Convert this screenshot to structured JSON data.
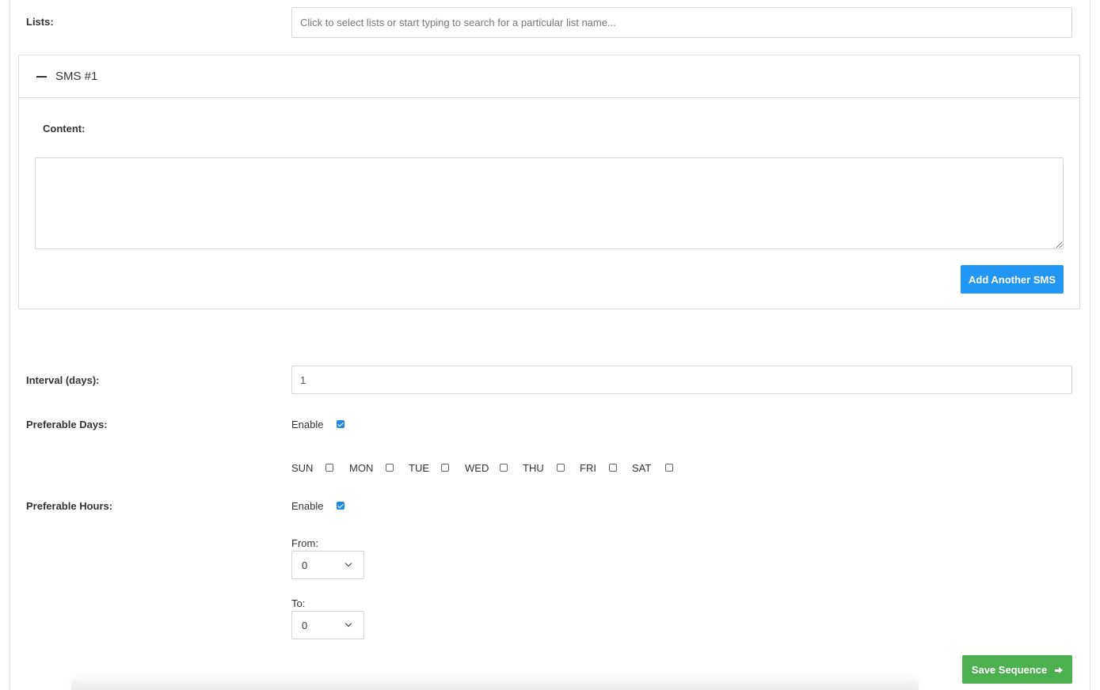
{
  "lists": {
    "label": "Lists:",
    "placeholder": "Click to select lists or start typing to search for a particular list name..."
  },
  "sms_panel": {
    "title": "SMS #1",
    "collapse_icon": "minus-icon",
    "content_label": "Content:",
    "content_value": "",
    "add_button_label": "Add Another SMS"
  },
  "interval": {
    "label": "Interval (days):",
    "value": "1"
  },
  "preferable_days": {
    "label": "Preferable Days:",
    "enable_label": "Enable",
    "enabled": true,
    "days": [
      {
        "label": "SUN",
        "checked": false
      },
      {
        "label": "MON",
        "checked": false
      },
      {
        "label": "TUE",
        "checked": false
      },
      {
        "label": "WED",
        "checked": false
      },
      {
        "label": "THU",
        "checked": false
      },
      {
        "label": "FRI",
        "checked": false
      },
      {
        "label": "SAT",
        "checked": false
      }
    ]
  },
  "preferable_hours": {
    "label": "Preferable Hours:",
    "enable_label": "Enable",
    "enabled": true,
    "from_label": "From:",
    "from_value": "0",
    "to_label": "To:",
    "to_value": "0"
  },
  "save_button": {
    "label": "Save Sequence",
    "icon": "arrow-right-icon"
  },
  "colors": {
    "primary_button": "#2196f3",
    "save_button": "#4caf50",
    "checkbox_checked": "#1e88e5"
  }
}
